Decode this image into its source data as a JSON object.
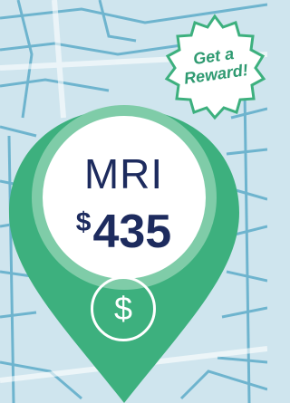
{
  "badge": {
    "line1": "Get a",
    "line2": "Reward!"
  },
  "pin": {
    "procedure": "MRI",
    "currency_symbol": "$",
    "price_amount": "435",
    "icon": "dollar-icon",
    "icon_glyph": "$"
  },
  "colors": {
    "map_background": "#cfe5ee",
    "map_roads": "#1f8db5",
    "pin_green": "#3db07e",
    "pin_ring": "#7fcca8",
    "text_navy": "#1d2b5e",
    "badge_text": "#2f9a71"
  }
}
